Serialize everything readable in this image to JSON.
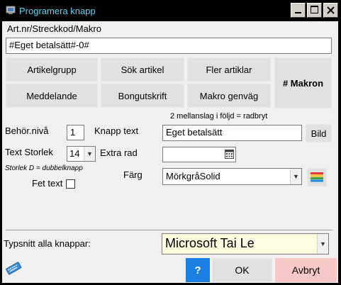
{
  "window": {
    "title": "Programera knapp"
  },
  "artnr": {
    "label": "Art.nr/Streckkod/Makro",
    "value": "#Eget betalsätt#-0#"
  },
  "grid_buttons": {
    "artikelgrupp": "Artikelgrupp",
    "sok_artikel": "Sök artikel",
    "fler_artiklar": "Fler artiklar",
    "makron": "# Makron",
    "meddelande": "Meddelande",
    "bongutskrift": "Bongutskrift",
    "makro_genvag": "Makro genväg"
  },
  "hint": "2 mellanslag i följd = radbryt",
  "behor": {
    "label": "Behör.nivå",
    "value": "1"
  },
  "knapp_text": {
    "label": "Knapp text",
    "value": "Eget betalsätt"
  },
  "bild_button": "Bild",
  "text_storlek": {
    "label": "Text Storlek",
    "value": "14",
    "note": "Storlek D = dubbelknapp"
  },
  "extra_rad": {
    "label": "Extra rad",
    "value": ""
  },
  "farg": {
    "label": "Färg",
    "value": "MörkgråSolid"
  },
  "fet_text": {
    "label": "Fet text",
    "checked": false
  },
  "typsnitt": {
    "label": "Typsnitt alla knappar:",
    "value": "Microsoft Tai Le"
  },
  "footer": {
    "help": "?",
    "ok": "OK",
    "cancel": "Avbryt"
  },
  "colors": {
    "help_bg": "#1a7fe0",
    "cancel_bg": "#f6c8c8",
    "font_bg": "#fdfbe0",
    "title_fg": "#5ed6f5"
  },
  "icons": {
    "app": "app-icon",
    "calendar": "calendar-icon",
    "palette": "palette-icon",
    "keyboard": "keyboard-icon"
  }
}
